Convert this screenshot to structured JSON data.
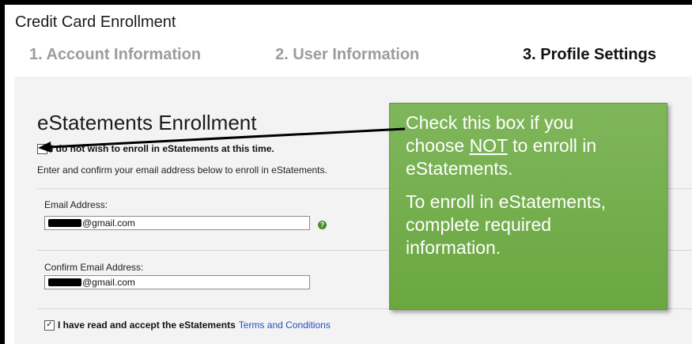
{
  "window": {
    "title": "Credit Card Enrollment"
  },
  "steps": [
    {
      "label": "1.  Account Information",
      "state": "complete"
    },
    {
      "label": "2.  User Information",
      "state": "complete"
    },
    {
      "label": "3.  Profile Settings",
      "state": "current"
    }
  ],
  "section": {
    "title": "eStatements Enrollment",
    "optout_label": "I do not wish to enroll in eStatements at this time.",
    "optout_checked": false,
    "instructions": "Enter and confirm your email address below to enroll in eStatements."
  },
  "email": {
    "label": "Email Address:",
    "value": "@gmail.com",
    "help_icon": "question-icon"
  },
  "confirm_email": {
    "label": "Confirm Email Address:",
    "value": "@gmail.com"
  },
  "terms": {
    "checked": true,
    "text": "I have read and accept the eStatements",
    "link_text": "Terms and Conditions"
  },
  "callout": {
    "lines_1": [
      "Check this box if you",
      "choose",
      "NOT",
      "to enroll in",
      "eStatements."
    ],
    "lines_2": [
      "To enroll in eStatements,",
      "complete required",
      "information."
    ]
  },
  "colors": {
    "callout_bg": "#6fab46",
    "link": "#1f4fc4",
    "muted_step": "#9c9c9c",
    "help_icon": "#4b8a2d"
  }
}
